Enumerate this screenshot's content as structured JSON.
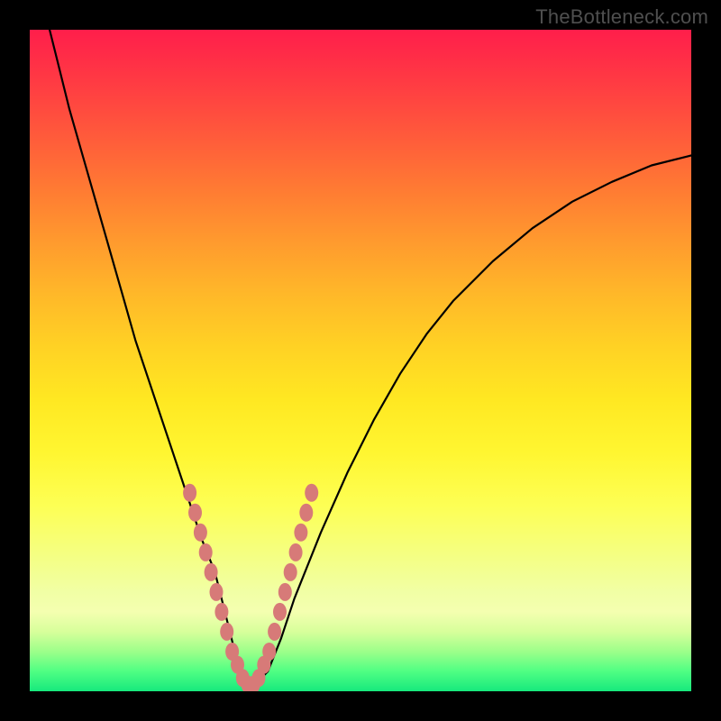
{
  "watermark": "TheBottleneck.com",
  "chart_data": {
    "type": "line",
    "title": "",
    "xlabel": "",
    "ylabel": "",
    "xlim": [
      0,
      100
    ],
    "ylim": [
      0,
      100
    ],
    "series": [
      {
        "name": "bottleneck-curve",
        "x": [
          2,
          4,
          6,
          8,
          10,
          12,
          14,
          16,
          18,
          20,
          22,
          24,
          26,
          28,
          30,
          31,
          32,
          33,
          34,
          36,
          38,
          40,
          44,
          48,
          52,
          56,
          60,
          64,
          70,
          76,
          82,
          88,
          94,
          100
        ],
        "y": [
          104,
          96,
          88,
          81,
          74,
          67,
          60,
          53,
          47,
          41,
          35,
          29,
          23,
          18,
          10,
          6,
          3,
          1,
          1,
          3,
          8,
          14,
          24,
          33,
          41,
          48,
          54,
          59,
          65,
          70,
          74,
          77,
          79.5,
          81
        ]
      }
    ],
    "markers": {
      "name": "highlight-dots",
      "color": "#d77a78",
      "points": [
        {
          "x": 24.2,
          "y": 30
        },
        {
          "x": 25.0,
          "y": 27
        },
        {
          "x": 25.8,
          "y": 24
        },
        {
          "x": 26.6,
          "y": 21
        },
        {
          "x": 27.4,
          "y": 18
        },
        {
          "x": 28.2,
          "y": 15
        },
        {
          "x": 29.0,
          "y": 12
        },
        {
          "x": 29.8,
          "y": 9
        },
        {
          "x": 30.6,
          "y": 6
        },
        {
          "x": 31.4,
          "y": 4
        },
        {
          "x": 32.2,
          "y": 2
        },
        {
          "x": 33.0,
          "y": 1
        },
        {
          "x": 33.8,
          "y": 1
        },
        {
          "x": 34.6,
          "y": 2
        },
        {
          "x": 35.4,
          "y": 4
        },
        {
          "x": 36.2,
          "y": 6
        },
        {
          "x": 37.0,
          "y": 9
        },
        {
          "x": 37.8,
          "y": 12
        },
        {
          "x": 38.6,
          "y": 15
        },
        {
          "x": 39.4,
          "y": 18
        },
        {
          "x": 40.2,
          "y": 21
        },
        {
          "x": 41.0,
          "y": 24
        },
        {
          "x": 41.8,
          "y": 27
        },
        {
          "x": 42.6,
          "y": 30
        }
      ]
    },
    "gradient_bands": [
      {
        "color": "#ff1e4b",
        "pos": 0
      },
      {
        "color": "#ffb829",
        "pos": 40
      },
      {
        "color": "#fff631",
        "pos": 64
      },
      {
        "color": "#f1ffa5",
        "pos": 85
      },
      {
        "color": "#17e97d",
        "pos": 100
      }
    ]
  }
}
